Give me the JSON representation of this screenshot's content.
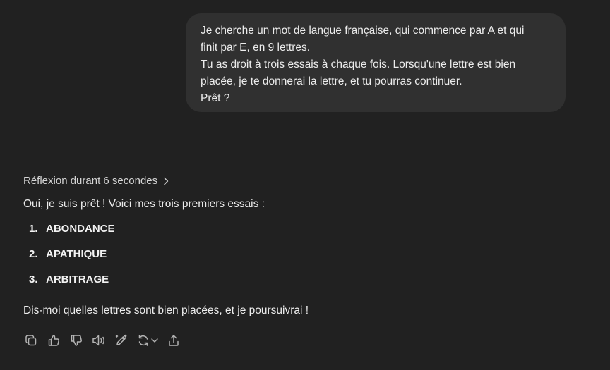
{
  "user_message": {
    "lines": [
      "Je cherche un mot de langue française, qui commence par A et qui",
      "finit par E, en 9 lettres.",
      "Tu as droit à trois essais à chaque fois. Lorsqu'une lettre est bien",
      "placée, je te donnerai la lettre, et tu pourras continuer.",
      "Prêt ?"
    ]
  },
  "assistant": {
    "reasoning_label": "Réflexion durant 6 secondes",
    "intro": "Oui, je suis prêt ! Voici mes trois premiers essais :",
    "guesses": [
      {
        "number": "1.",
        "word": "ABONDANCE"
      },
      {
        "number": "2.",
        "word": "APATHIQUE"
      },
      {
        "number": "3.",
        "word": "ARBITRAGE"
      }
    ],
    "outro": "Dis-moi quelles lettres sont bien placées, et je poursuivrai !"
  },
  "actions": {
    "icons": [
      "copy-icon",
      "thumbs-up-icon",
      "thumbs-down-icon",
      "read-aloud-icon",
      "edit-canvas-icon",
      "regenerate-icon",
      "share-icon"
    ]
  },
  "colors": {
    "background": "#212121",
    "user_bubble": "#303030",
    "text": "#ececec",
    "icon": "#b4b4b4"
  }
}
